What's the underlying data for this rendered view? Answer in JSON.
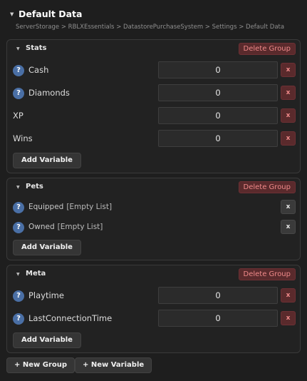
{
  "panel": {
    "title": "Default Data",
    "breadcrumb": "ServerStorage > RBLXEssentials > DatastorePurchaseSystem > Settings > Default Data"
  },
  "icons": {
    "help": "?",
    "remove": "x",
    "caret": "▼"
  },
  "colors": {
    "background": "#1e1e1e",
    "danger": "#f08a8a",
    "danger_bg": "#5a2a2c",
    "help_icon": "#4a6fa5"
  },
  "groups": [
    {
      "name": "Stats",
      "delete_label": "Delete Group",
      "add_label": "Add Variable",
      "variables": [
        {
          "name": "Cash",
          "value": "0"
        },
        {
          "name": "Diamonds",
          "value": "0"
        },
        {
          "name": "XP",
          "value": "0"
        },
        {
          "name": "Wins",
          "value": "0"
        }
      ]
    },
    {
      "name": "Pets",
      "delete_label": "Delete Group",
      "add_label": "Add Variable",
      "variables": [
        {
          "name": "Equipped",
          "empty": "[Empty List]"
        },
        {
          "name": "Owned",
          "empty": "[Empty List]"
        }
      ]
    },
    {
      "name": "Meta",
      "delete_label": "Delete Group",
      "add_label": "Add Variable",
      "variables": [
        {
          "name": "Playtime",
          "value": "0"
        },
        {
          "name": "LastConnectionTime",
          "value": "0"
        }
      ]
    }
  ],
  "footer": {
    "new_group_label": "+ New Group",
    "new_variable_label": "+ New Variable"
  }
}
